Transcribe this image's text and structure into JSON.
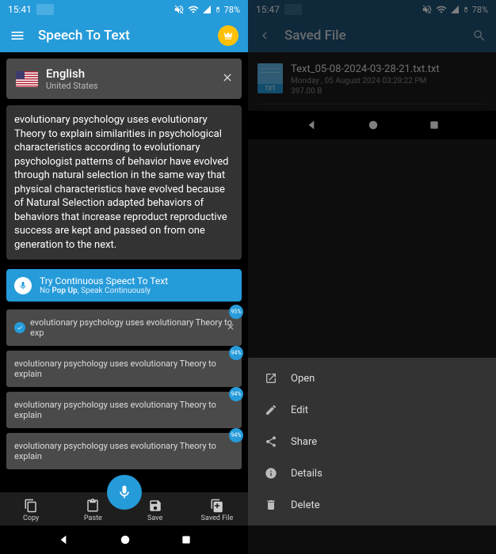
{
  "left": {
    "status": {
      "time": "15:41",
      "battery": "78%"
    },
    "appTitle": "Speech To Text",
    "language": {
      "name": "English",
      "sub": "United States"
    },
    "text": "evolutionary psychology uses evolutionary Theory to explain similarities in psychological characteristics according to evolutionary psychologist patterns of behavior have evolved through natural selection in the same way that physical characteristics have evolved because of Natural Selection adapted behaviors of behaviors that increase reproduct reproductive success are kept and passed on from one generation to the next.",
    "banner": {
      "title": "Try Continuous Speect To Text",
      "sub": "No Pop Up, Speak Continuously"
    },
    "history": [
      {
        "text": "evolutionary psychology uses evolutionary Theory to exp",
        "pct": "95%",
        "selected": true,
        "closable": true
      },
      {
        "text": "evolutionary psychology uses evolutionary Theory to explain",
        "pct": "94%"
      },
      {
        "text": "evolutionary psychology uses evolutionary Theory to explain",
        "pct": "94%"
      },
      {
        "text": "evolutionary psychology uses evolutionary Theory to explain",
        "pct": "94%"
      }
    ],
    "bottom": {
      "copy": "Copy",
      "paste": "Paste",
      "save": "Save",
      "saved": "Saved File"
    }
  },
  "right": {
    "status": {
      "time": "15:47",
      "battery": "78%"
    },
    "appTitle": "Saved File",
    "file": {
      "iconLabel": "TXT",
      "name": "Text_05-08-2024-03-28-21.txt.txt",
      "date": "Monday , 05 August 2024 03:28:22 PM",
      "size": "397.00 B"
    },
    "menu": {
      "open": "Open",
      "edit": "Edit",
      "share": "Share",
      "details": "Details",
      "delete": "Delete"
    }
  }
}
